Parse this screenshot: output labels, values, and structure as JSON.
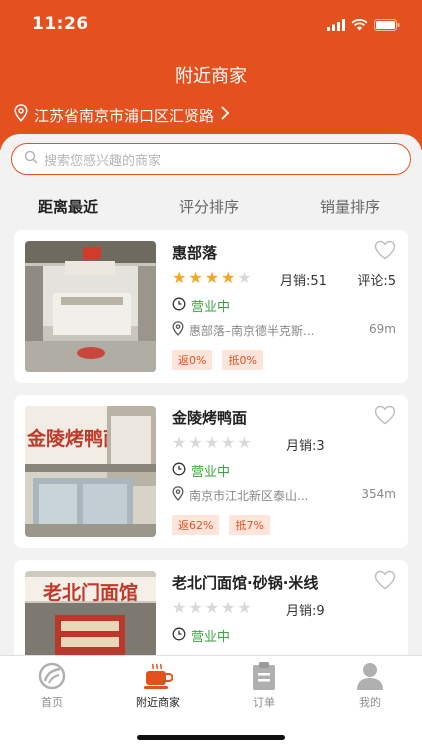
{
  "status": {
    "time": "11:26"
  },
  "header": {
    "title": "附近商家",
    "location": "江苏省南京市浦口区汇贤路"
  },
  "search": {
    "placeholder": "搜索您感兴趣的商家"
  },
  "tabs": [
    "距离最近",
    "评分排序",
    "销量排序"
  ],
  "shops": [
    {
      "name": "惠部落",
      "rating": 4,
      "sales": "月销:51",
      "reviews": "评论:5",
      "status": "营业中",
      "address": "惠部落–南京德半克斯...",
      "distance": "69m",
      "tags": [
        "返0%",
        "抵0%"
      ]
    },
    {
      "name": "金陵烤鸭面",
      "rating": 0,
      "sales": "月销:3",
      "status": "营业中",
      "address": "南京市江北新区泰山...",
      "distance": "354m",
      "tags": [
        "返62%",
        "抵7%"
      ]
    },
    {
      "name": "老北门面馆·砂锅·米线",
      "rating": 0,
      "sales": "月销:9",
      "status": "营业中"
    }
  ],
  "thumb_text": {
    "shop2": "金陵烤鸭面",
    "shop3": "老北门面馆"
  },
  "tabbar": [
    {
      "label": "首页",
      "icon": "home-icon"
    },
    {
      "label": "附近商家",
      "icon": "coffee-cup-icon"
    },
    {
      "label": "订单",
      "icon": "clipboard-icon"
    },
    {
      "label": "我的",
      "icon": "user-icon"
    }
  ],
  "colors": {
    "accent": "#e5511e",
    "open_green": "#3aa540",
    "star_active": "#f5a623",
    "star_inactive": "#d9d9d9"
  }
}
